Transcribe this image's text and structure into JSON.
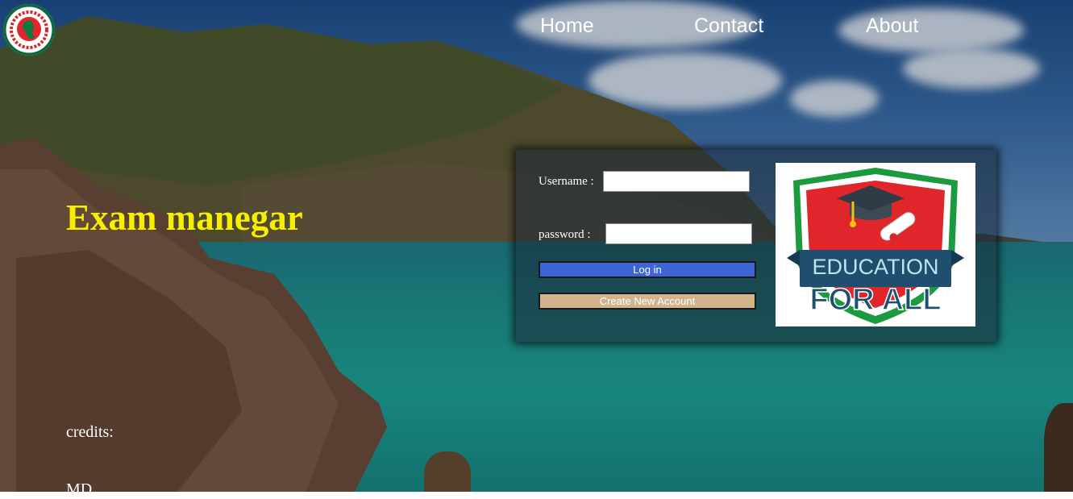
{
  "header": {
    "nav": [
      {
        "label": "Home"
      },
      {
        "label": "Contact"
      },
      {
        "label": "About"
      }
    ]
  },
  "hero": {
    "title": "Exam manegar"
  },
  "login": {
    "username_label": "Username :",
    "password_label": "password :",
    "username_value": "",
    "password_value": "",
    "login_button": "Log in",
    "create_button": "Create New Account"
  },
  "badge": {
    "line1": "EDUCATION",
    "line2": "FOR ALL"
  },
  "footer": {
    "credits_label": "credits:",
    "author": "MD"
  },
  "colors": {
    "title": "#f6f000",
    "login_button": "#3e64d6",
    "create_button": "#d2b48c",
    "badge_green": "#1c9a3e",
    "badge_red": "#e0262b",
    "badge_navy": "#1f4e6e"
  },
  "icons": [
    "government-seal-icon",
    "graduation-cap-icon",
    "diploma-scroll-icon"
  ]
}
